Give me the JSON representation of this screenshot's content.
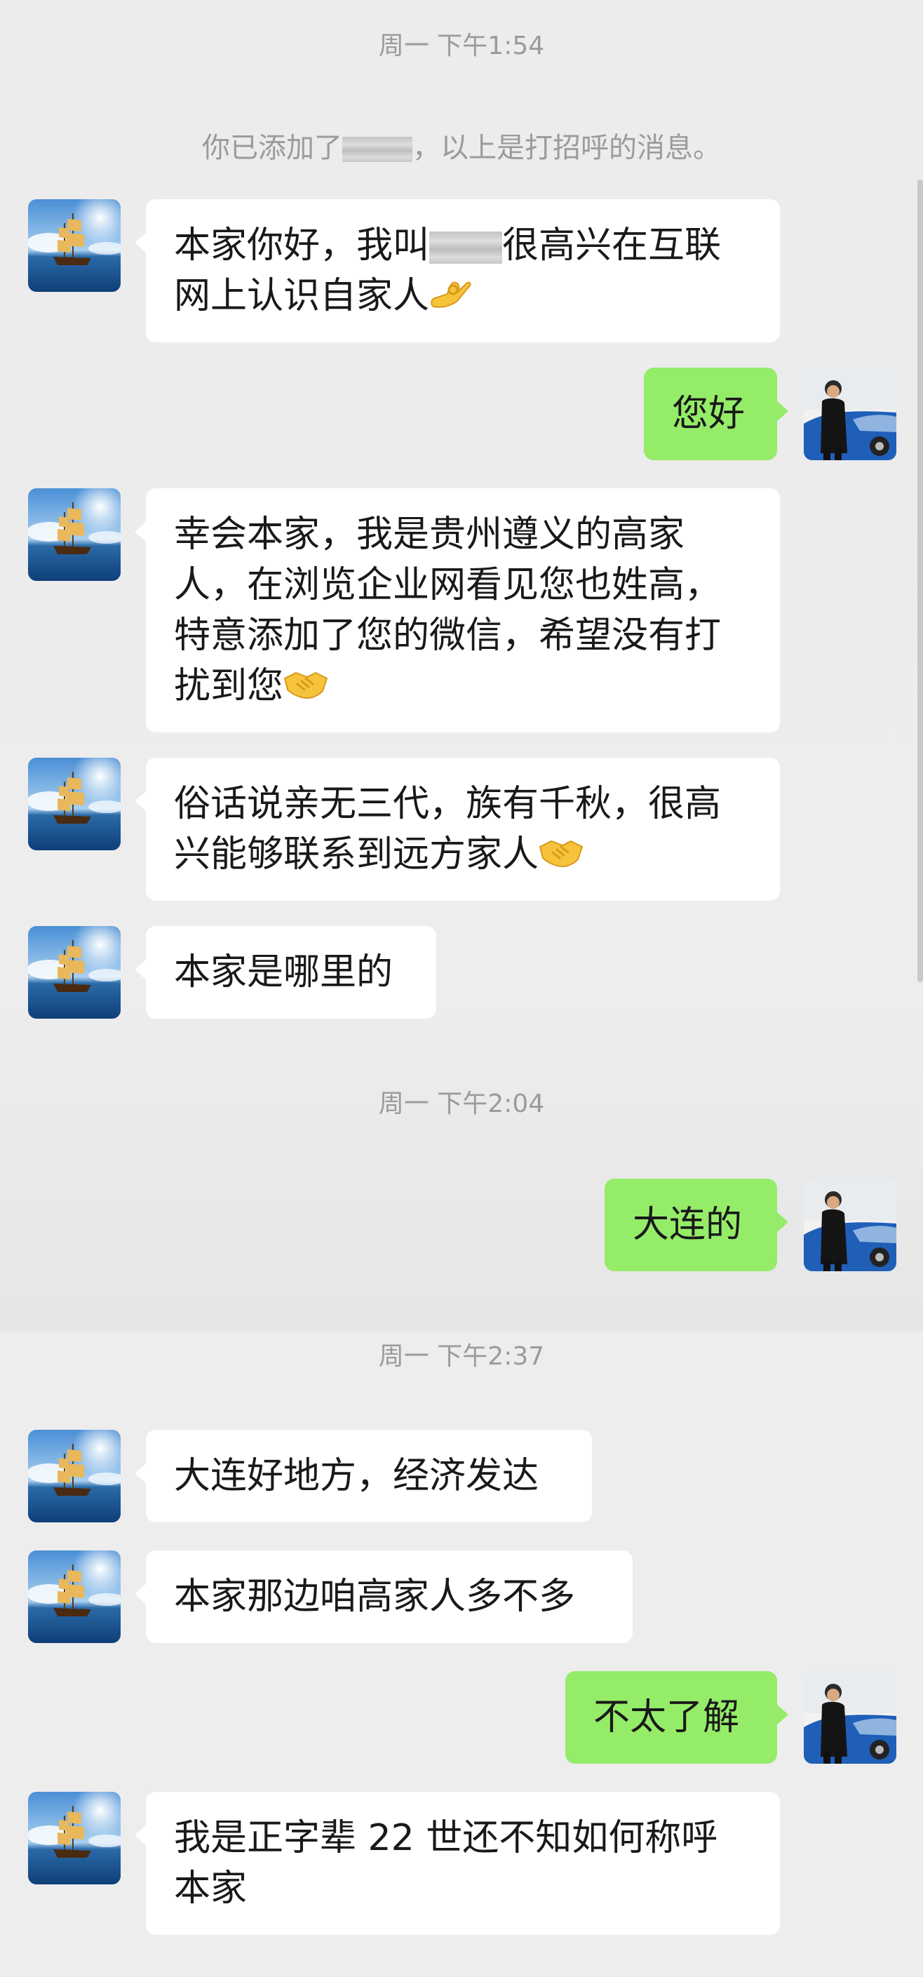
{
  "timestamps": [
    "周一 下午1:54",
    "周一 下午2:04",
    "周一 下午2:37"
  ],
  "system": {
    "added_prefix": "你已添加了",
    "added_suffix": "，以上是打招呼的消息。"
  },
  "messages": [
    {
      "side": "in",
      "parts": [
        "本家你好，我叫",
        "很高兴在互联",
        "网上认识自家人"
      ],
      "emoji": "ok-hand-emoji"
    },
    {
      "side": "out",
      "text": "您好"
    },
    {
      "side": "in",
      "lines": [
        "幸会本家，我是贵州遵义的高家",
        "人，在浏览企业网看见您也姓高，",
        "特意添加了您的微信，希望没有打",
        "扰到您"
      ],
      "emoji": "handshake-emoji"
    },
    {
      "side": "in",
      "lines": [
        "俗话说亲无三代，族有千秋，很高",
        "兴能够联系到远方家人"
      ],
      "emoji": "handshake-emoji"
    },
    {
      "side": "in",
      "text": "本家是哪里的"
    },
    {
      "side": "out",
      "text": "大连的"
    },
    {
      "side": "in",
      "text": "大连好地方，经济发达"
    },
    {
      "side": "in",
      "text": "本家那边咱高家人多不多"
    },
    {
      "side": "out",
      "text": "不太了解"
    },
    {
      "side": "in",
      "lines": [
        "我是正字辈 22 世还不知如何称呼",
        "本家"
      ]
    }
  ],
  "colors": {
    "background": "#ededed",
    "incoming_bubble": "#ffffff",
    "outgoing_bubble": "#95ec69",
    "timestamp_text": "#9b9b9b"
  },
  "avatars": {
    "contact": "sailing-ship-avatar",
    "self": "man-with-car-avatar"
  }
}
